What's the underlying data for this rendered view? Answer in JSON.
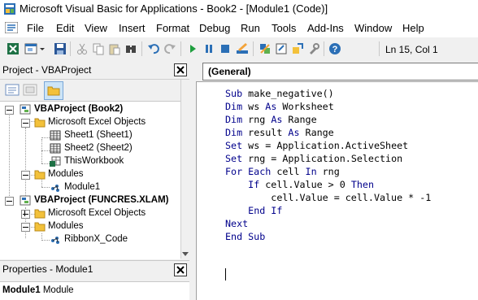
{
  "window": {
    "title": "Microsoft Visual Basic for Applications - Book2 - [Module1 (Code)]"
  },
  "menu": {
    "items": [
      "File",
      "Edit",
      "View",
      "Insert",
      "Format",
      "Debug",
      "Run",
      "Tools",
      "Add-Ins",
      "Window",
      "Help"
    ]
  },
  "toolbar": {
    "icons": [
      "excel-view-icon",
      "insert-object-icon",
      "dropdown-arrow-icon",
      "save-icon",
      "cut-icon",
      "copy-icon",
      "paste-icon",
      "find-icon",
      "undo-icon",
      "redo-icon",
      "run-icon",
      "break-icon",
      "reset-icon",
      "design-mode-icon",
      "project-explorer-icon",
      "properties-icon",
      "object-browser-icon",
      "toolbox-icon",
      "help-icon"
    ],
    "status": "Ln 15, Col 1"
  },
  "project_pane": {
    "title": "Project - VBAProject",
    "tree": [
      {
        "label": "VBAProject (Book2)",
        "bold": true
      },
      {
        "label": "Microsoft Excel Objects",
        "bold": false
      },
      {
        "label": "Sheet1 (Sheet1)",
        "bold": false
      },
      {
        "label": "Sheet2 (Sheet2)",
        "bold": false
      },
      {
        "label": "ThisWorkbook",
        "bold": false
      },
      {
        "label": "Modules",
        "bold": false
      },
      {
        "label": "Module1",
        "bold": false
      },
      {
        "label": "VBAProject (FUNCRES.XLAM)",
        "bold": true
      },
      {
        "label": "Microsoft Excel Objects",
        "bold": false
      },
      {
        "label": "Modules",
        "bold": false
      },
      {
        "label": "RibbonX_Code",
        "bold": false
      }
    ]
  },
  "properties_pane": {
    "title": "Properties - Module1",
    "object_name": "Module1",
    "object_type": "Module"
  },
  "code_window": {
    "object_combo": "(General)",
    "lines": [
      [
        [
          "kw",
          "Sub"
        ],
        [
          "t",
          " make_negative()"
        ]
      ],
      [
        [
          "kw",
          "Dim"
        ],
        [
          "t",
          " ws "
        ],
        [
          "kw",
          "As"
        ],
        [
          "t",
          " Worksheet"
        ]
      ],
      [
        [
          "kw",
          "Dim"
        ],
        [
          "t",
          " rng "
        ],
        [
          "kw",
          "As"
        ],
        [
          "t",
          " Range"
        ]
      ],
      [
        [
          "kw",
          "Dim"
        ],
        [
          "t",
          " result "
        ],
        [
          "kw",
          "As"
        ],
        [
          "t",
          " Range"
        ]
      ],
      [
        [
          "kw",
          "Set"
        ],
        [
          "t",
          " ws = Application.ActiveSheet"
        ]
      ],
      [
        [
          "kw",
          "Set"
        ],
        [
          "t",
          " rng = Application.Selection"
        ]
      ],
      [
        [
          "kw",
          "For Each"
        ],
        [
          "t",
          " cell "
        ],
        [
          "kw",
          "In"
        ],
        [
          "t",
          " rng"
        ]
      ],
      [
        [
          "t",
          "    "
        ],
        [
          "kw",
          "If"
        ],
        [
          "t",
          " cell.Value > 0 "
        ],
        [
          "kw",
          "Then"
        ]
      ],
      [
        [
          "t",
          "        cell.Value = cell.Value * -1"
        ]
      ],
      [
        [
          "t",
          "    "
        ],
        [
          "kw",
          "End If"
        ]
      ],
      [
        [
          "kw",
          "Next"
        ]
      ],
      [
        [
          "kw",
          "End Sub"
        ]
      ]
    ]
  }
}
